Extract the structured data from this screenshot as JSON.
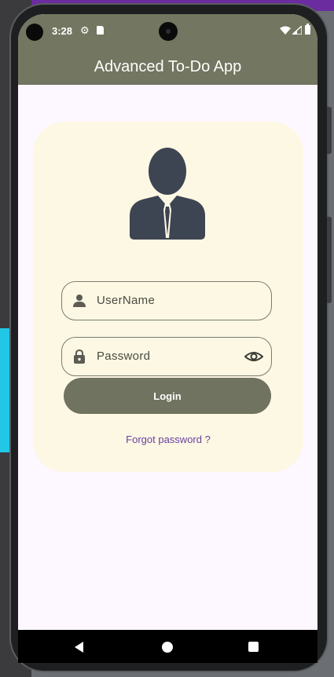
{
  "status_bar": {
    "time": "3:28"
  },
  "app": {
    "title": "Advanced To-Do App"
  },
  "login_form": {
    "username_placeholder": "UserName",
    "password_placeholder": "Password",
    "login_label": "Login",
    "forgot_label": "Forgot password ?"
  },
  "icons": {
    "avatar": "businessman-icon",
    "username": "person-icon",
    "password": "lock-icon",
    "visibility": "eye-icon"
  },
  "colors": {
    "app_bar": "#737660",
    "card": "#fcf8e3",
    "button": "#6f7360",
    "link": "#6a3fa0",
    "screen_bg": "#fdf7ff"
  }
}
